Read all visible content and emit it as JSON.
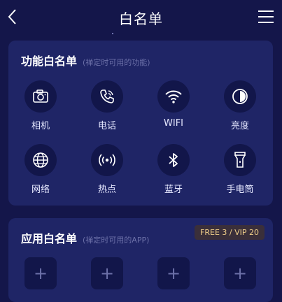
{
  "header": {
    "title": "白名单",
    "back_icon": "chevron-left-icon",
    "menu_icon": "hamburger-menu-icon"
  },
  "features": {
    "title": "功能白名单",
    "subtitle": "(禅定时可用的功能)",
    "items": [
      {
        "label": "相机",
        "icon": "camera-icon"
      },
      {
        "label": "电话",
        "icon": "phone-icon"
      },
      {
        "label": "WIFI",
        "icon": "wifi-icon"
      },
      {
        "label": "亮度",
        "icon": "brightness-icon"
      },
      {
        "label": "网络",
        "icon": "globe-icon"
      },
      {
        "label": "热点",
        "icon": "hotspot-icon"
      },
      {
        "label": "蓝牙",
        "icon": "bluetooth-icon"
      },
      {
        "label": "手电筒",
        "icon": "flashlight-icon"
      }
    ]
  },
  "apps": {
    "title": "应用白名单",
    "subtitle": "(禅定时可用的APP)",
    "badge": "FREE 3 / VIP 20",
    "add_symbol": "+"
  },
  "colors": {
    "background": "#14164a",
    "card": "#1f2566",
    "icon_circle": "#12164a",
    "badge_text": "#f0cf8a"
  }
}
